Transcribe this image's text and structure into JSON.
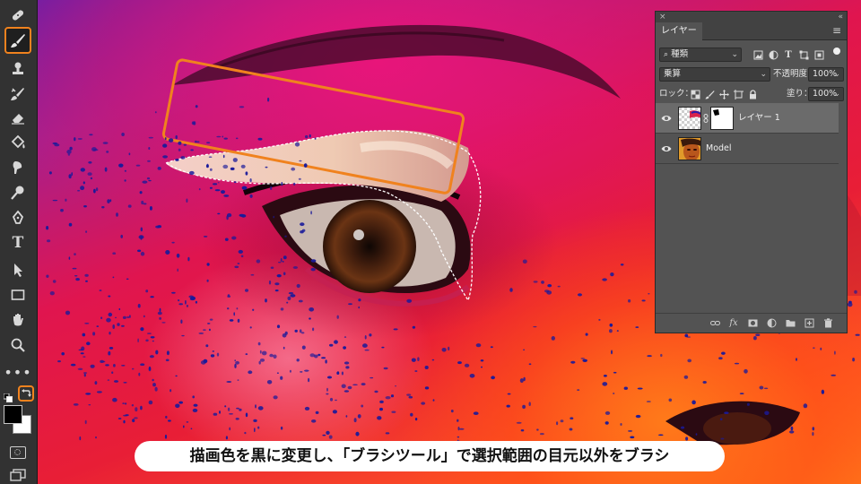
{
  "toolbar": {
    "tools": [
      {
        "name": "healing-brush-tool",
        "icon": "bandage-icon"
      },
      {
        "name": "brush-tool",
        "icon": "brush-icon",
        "active": true
      },
      {
        "name": "clone-stamp-tool",
        "icon": "stamp-icon"
      },
      {
        "name": "history-brush-tool",
        "icon": "history-brush-icon"
      },
      {
        "name": "eraser-tool",
        "icon": "eraser-icon"
      },
      {
        "name": "paint-bucket-tool",
        "icon": "paint-bucket-icon"
      },
      {
        "name": "smudge-tool",
        "icon": "smudge-icon"
      },
      {
        "name": "dodge-tool",
        "icon": "dodge-icon"
      },
      {
        "name": "pen-tool",
        "icon": "pen-icon"
      },
      {
        "name": "type-tool",
        "icon": "type-icon",
        "glyph": "T"
      },
      {
        "name": "path-selection-tool",
        "icon": "arrow-icon"
      },
      {
        "name": "rectangle-tool",
        "icon": "rectangle-icon"
      },
      {
        "name": "hand-tool",
        "icon": "hand-icon"
      },
      {
        "name": "zoom-tool",
        "icon": "magnifier-icon"
      },
      {
        "name": "more-tools",
        "icon": "ellipsis-icon",
        "glyph": "•••"
      }
    ],
    "foreground_color": "#000000",
    "background_color": "#ffffff",
    "accent": "#f0821e"
  },
  "layers_panel": {
    "top_left": "×",
    "top_right": "«",
    "tab_label": "レイヤー",
    "filter_label": "種類",
    "blend_mode": "乗算",
    "opacity_label": "不透明度：",
    "opacity_value": "100%",
    "lock_label": "ロック：",
    "fill_label": "塗り：",
    "fill_value": "100%",
    "layers": [
      {
        "name": "レイヤー 1",
        "visible": true,
        "selected": true,
        "has_mask": true
      },
      {
        "name": "Model",
        "visible": true,
        "selected": false,
        "has_mask": false
      }
    ],
    "footer_icons": [
      "link-icon",
      "fx-icon",
      "mask-icon",
      "adjustment-icon",
      "folder-icon",
      "new-layer-icon",
      "trash-icon"
    ],
    "footer_fx": "fx"
  },
  "caption": {
    "text": "描画色を黒に変更し、「ブラシツール」で選択範囲の目元以外をブラシ"
  },
  "colors": {
    "highlight": "#f0821e",
    "panel_bg": "#535353",
    "selected_row": "#6b6b6b",
    "speckle": "#1a1a9a"
  }
}
